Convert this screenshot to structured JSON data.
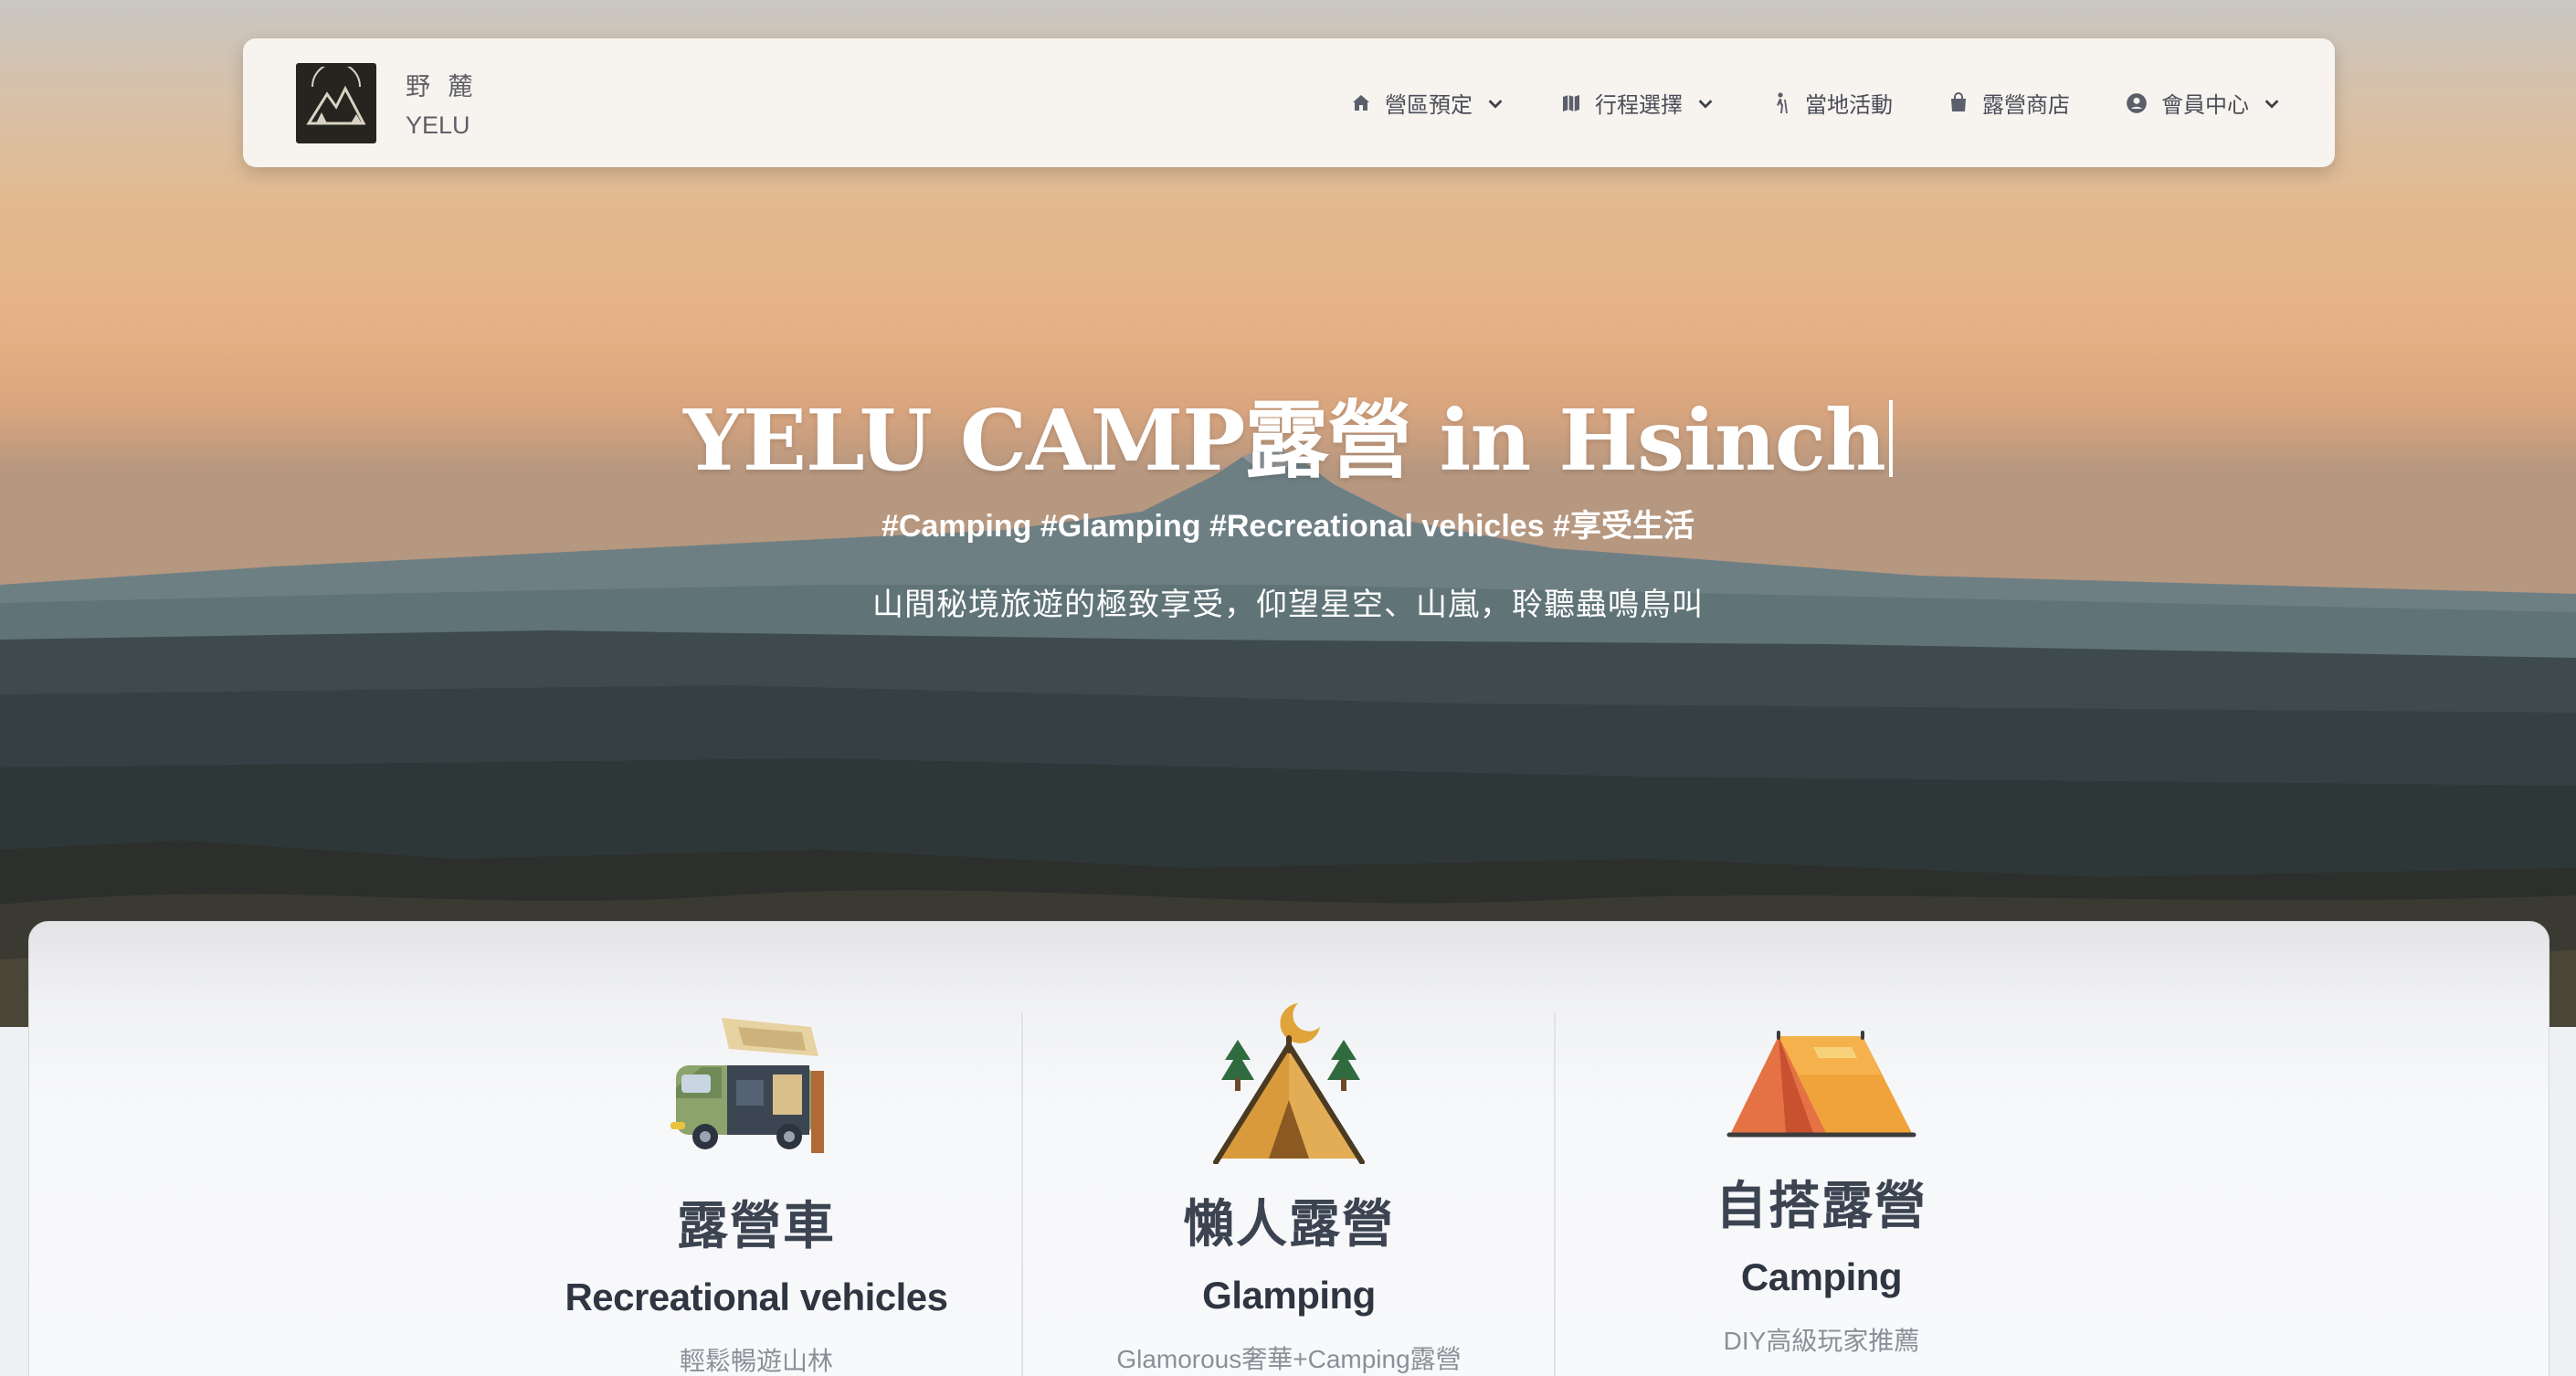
{
  "navbar": {
    "brand_zh": "野 麓",
    "brand_en": "YELU",
    "items": [
      {
        "label": "營區預定",
        "icon": "home-icon",
        "dropdown": true
      },
      {
        "label": "行程選擇",
        "icon": "map-icon",
        "dropdown": true
      },
      {
        "label": "當地活動",
        "icon": "hiking-icon",
        "dropdown": false
      },
      {
        "label": "露營商店",
        "icon": "shopping-bag-icon",
        "dropdown": false
      },
      {
        "label": "會員中心",
        "icon": "account-circle-icon",
        "dropdown": true
      }
    ]
  },
  "hero": {
    "title": "YELU CAMP露營 in Hsinch",
    "tags": "#Camping #Glamping #Recreational vehicles #享受生活",
    "description": "山間秘境旅遊的極致享受，仰望星空、山嵐，聆聽蟲鳴鳥叫"
  },
  "features": [
    {
      "icon": "camper-van-icon",
      "zh_title": "露營車",
      "en_title": "Recreational vehicles",
      "subtitle": "輕鬆暢遊山林"
    },
    {
      "icon": "glamping-tent-icon",
      "zh_title": "懶人露營",
      "en_title": "Glamping",
      "subtitle": "Glamorous奢華+Camping露營"
    },
    {
      "icon": "camping-tent-icon",
      "zh_title": "自搭露營",
      "en_title": "Camping",
      "subtitle": "DIY高級玩家推薦"
    }
  ],
  "colors": {
    "sky_top": "#c9c6c3",
    "sky_glow": "#e6b48a",
    "navbar_bg": "#f7f3ee",
    "text_dark": "#3c4452",
    "text_muted": "#8b8f97"
  }
}
